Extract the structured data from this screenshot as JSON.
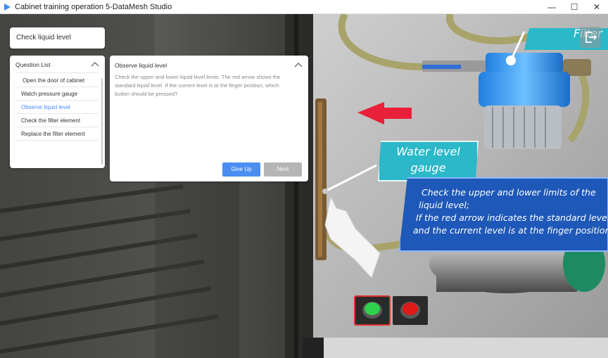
{
  "window": {
    "title": "Cabinet training operation 5-DataMesh Studio",
    "minimize_glyph": "—",
    "maximize_glyph": "☐",
    "close_glyph": "✕"
  },
  "task": {
    "label": "Check liquid level"
  },
  "question_list": {
    "title": "Question List",
    "items": [
      {
        "label": "Open the door of cabinet"
      },
      {
        "label": "Watch pressure gauge"
      },
      {
        "label": "Observe liquid level"
      },
      {
        "label": "Check the filter element"
      },
      {
        "label": "Replace the filter element"
      }
    ],
    "active_index": 2
  },
  "question": {
    "title": "Observe liquid level",
    "body": "Check the upper and lower liquid level limits. The red arrow shows the standard liquid level. If the current level is at the finger position, which button should be pressed?",
    "give_up_label": "Give Up",
    "next_label": "Next"
  },
  "scene": {
    "filter_tag": "Filter",
    "water_tag_line1": "Water level",
    "water_tag_line2": "gauge",
    "info_lines": [
      "Check the upper and lower limits of the",
      "liquid level;",
      "If the red arrow indicates the standard level",
      "and the current level is at the finger position"
    ]
  },
  "colors": {
    "accent": "#4a8ef2",
    "tag_cyan": "#2bb8c8",
    "info_blue": "#1e58b8",
    "arrow_red": "#e8203a",
    "button_green": "#2ed24a",
    "button_red": "#e01818"
  },
  "icons": {
    "app_logo": "app-logo-icon",
    "exit": "exit-icon",
    "collapse": "chevron-up-icon"
  }
}
